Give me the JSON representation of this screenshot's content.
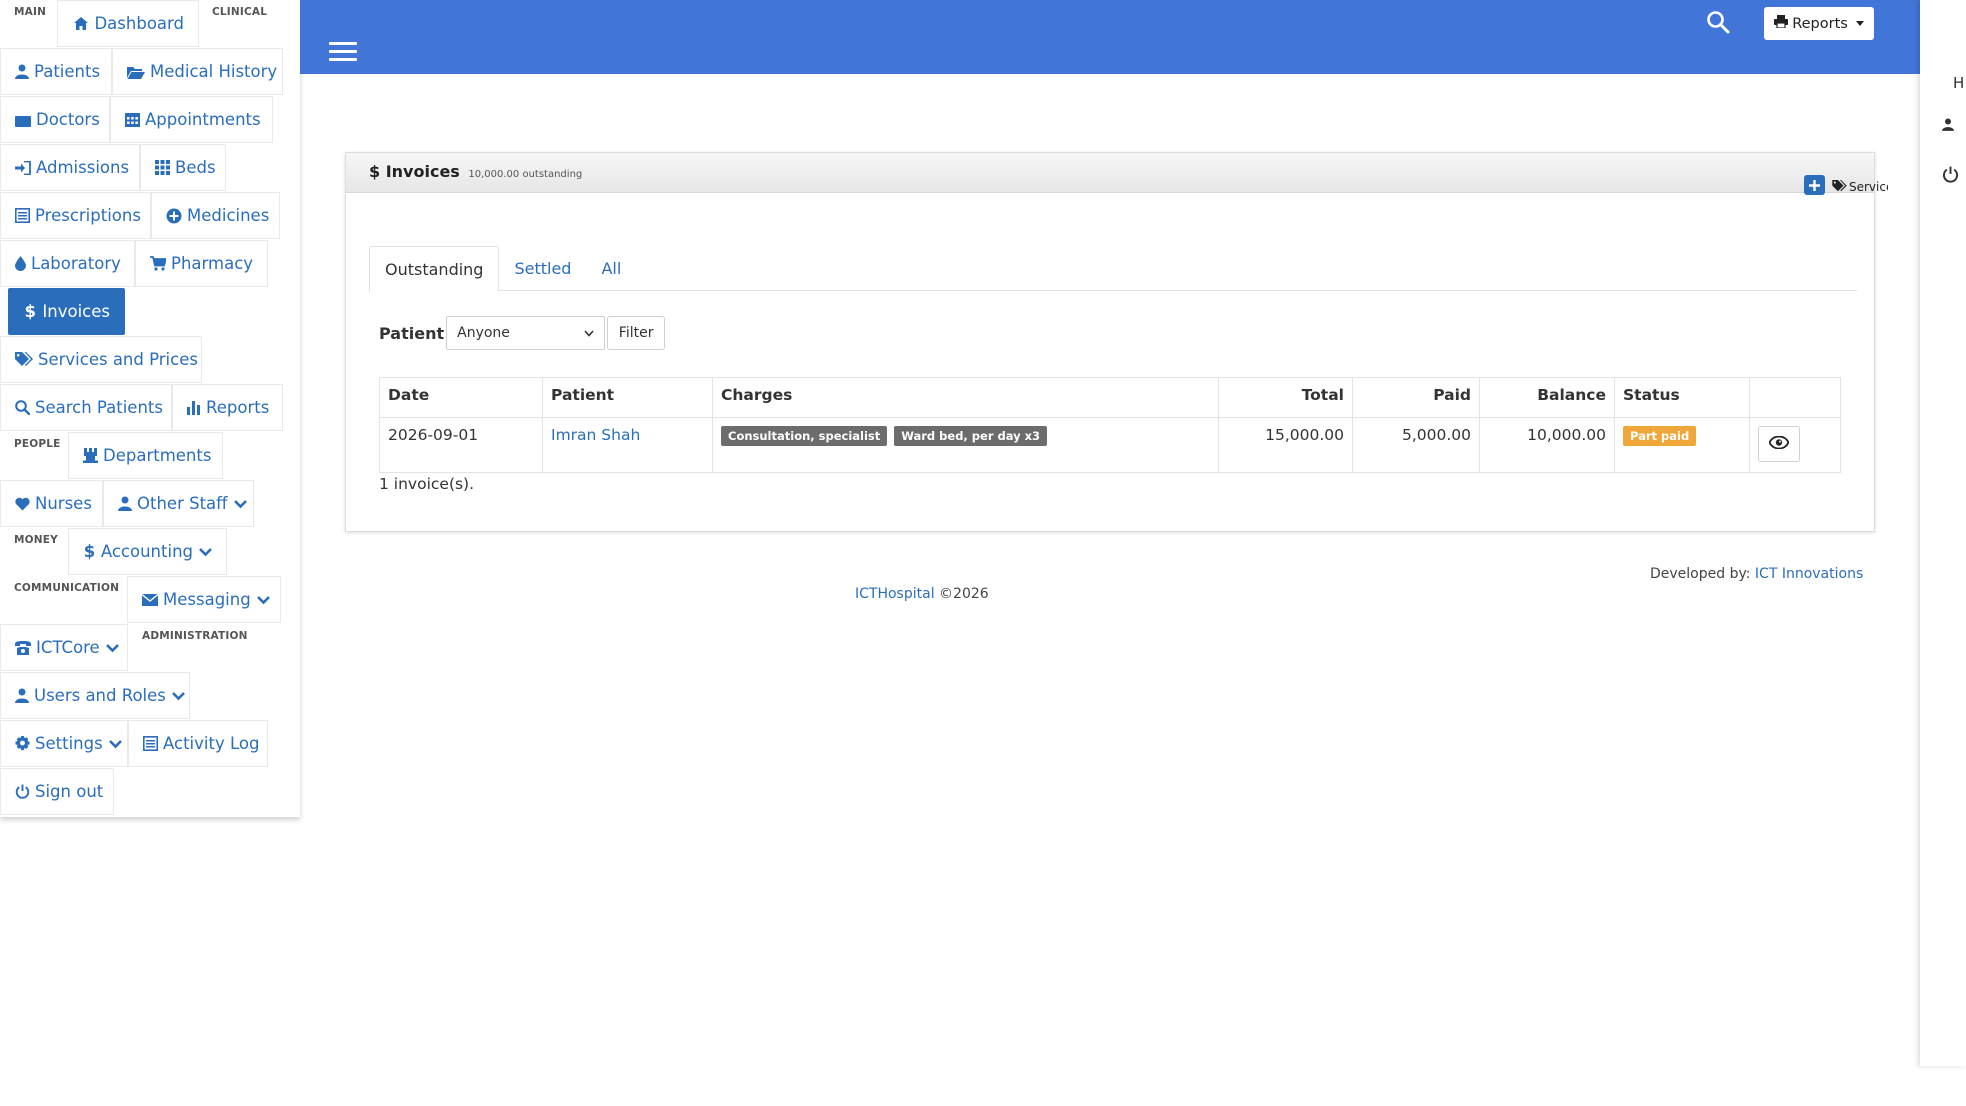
{
  "sidebar": {
    "groups": {
      "main": "MAIN",
      "clinical": "CLINICAL",
      "people": "PEOPLE",
      "money": "MONEY",
      "communication": "COMMUNICATION",
      "administration": "ADMINISTRATION"
    },
    "items": {
      "dashboard": "Dashboard",
      "patients": "Patients",
      "medical_history": "Medical History",
      "doctors": "Doctors",
      "appointments": "Appointments",
      "admissions": "Admissions",
      "beds": "Beds",
      "prescriptions": "Prescriptions",
      "medicines": "Medicines",
      "laboratory": "Laboratory",
      "pharmacy": "Pharmacy",
      "invoices": "Invoices",
      "services_and_prices": "Services and Prices",
      "search_patients": "Search Patients",
      "reports": "Reports",
      "departments": "Departments",
      "nurses": "Nurses",
      "other_staff": "Other Staff",
      "accounting": "Accounting",
      "messaging": "Messaging",
      "ictcore": "ICTCore",
      "users_and_roles": "Users and Roles",
      "settings": "Settings",
      "activity_log": "Activity Log",
      "sign_out": "Sign out"
    },
    "active_item": "invoices"
  },
  "topbar": {
    "reports_label": "Reports",
    "accent": "#4175d7"
  },
  "right_panel": {
    "letter": "H"
  },
  "panel": {
    "title": "Invoices",
    "subtitle": "10,000.00 outstanding",
    "services_link": "Services and Prices",
    "tabs": [
      {
        "label": "Outstanding",
        "active": true
      },
      {
        "label": "Settled",
        "active": false
      },
      {
        "label": "All",
        "active": false
      }
    ],
    "filter": {
      "label": "Patient",
      "selected": "Anyone",
      "button": "Filter"
    },
    "table": {
      "headers": {
        "date": "Date",
        "patient": "Patient",
        "charges": "Charges",
        "total": "Total",
        "paid": "Paid",
        "balance": "Balance",
        "status": "Status"
      },
      "rows": [
        {
          "date": "2026-09-01",
          "patient": "Imran Shah",
          "charges": [
            "Consultation, specialist",
            "Ward bed, per day x3"
          ],
          "total": "15,000.00",
          "paid": "5,000.00",
          "balance": "10,000.00",
          "status": "Part paid"
        }
      ]
    },
    "count_text": "1 invoice(s)."
  },
  "footer": {
    "developed_by": "Developed by:",
    "developer": "ICT Innovations",
    "app_name": "ICTHospital",
    "copyright": "©2026"
  },
  "colors": {
    "link": "#2a6ebb",
    "status_warning": "#f0a73a",
    "badge_dark": "#6c6c6c"
  }
}
